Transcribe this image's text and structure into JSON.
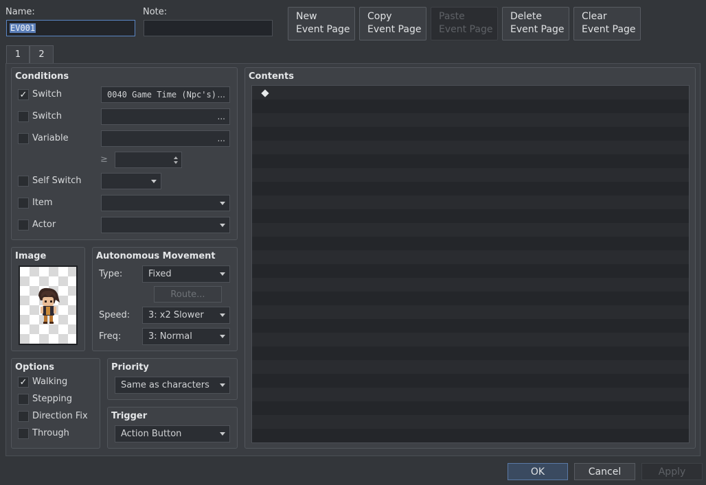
{
  "header": {
    "name_label": "Name:",
    "name_value": "EV001",
    "note_label": "Note:",
    "note_value": ""
  },
  "page_buttons": {
    "new_line1": "New",
    "new_line2": "Event Page",
    "copy_line1": "Copy",
    "copy_line2": "Event Page",
    "paste_line1": "Paste",
    "paste_line2": "Event Page",
    "delete_line1": "Delete",
    "delete_line2": "Event Page",
    "clear_line1": "Clear",
    "clear_line2": "Event Page"
  },
  "tabs": {
    "tab1": "1",
    "tab2": "2",
    "active": "2"
  },
  "conditions": {
    "title": "Conditions",
    "switch1": {
      "label": "Switch",
      "checked": true,
      "value": "0040 Game Time (Npc's)",
      "button": "..."
    },
    "switch2": {
      "label": "Switch",
      "checked": false,
      "value": "",
      "button": "..."
    },
    "variable": {
      "label": "Variable",
      "checked": false,
      "value": "",
      "button": "...",
      "operator": "≥",
      "compare_value": ""
    },
    "self_switch": {
      "label": "Self Switch",
      "checked": false,
      "value": ""
    },
    "item": {
      "label": "Item",
      "checked": false,
      "value": ""
    },
    "actor": {
      "label": "Actor",
      "checked": false,
      "value": ""
    }
  },
  "image": {
    "title": "Image",
    "sprite": "character-sprite"
  },
  "movement": {
    "title": "Autonomous Movement",
    "type_label": "Type:",
    "type_value": "Fixed",
    "route_button": "Route...",
    "speed_label": "Speed:",
    "speed_value": "3: x2 Slower",
    "freq_label": "Freq:",
    "freq_value": "3: Normal"
  },
  "options": {
    "title": "Options",
    "walking": {
      "label": "Walking",
      "checked": true
    },
    "stepping": {
      "label": "Stepping",
      "checked": false
    },
    "direction_fix": {
      "label": "Direction Fix",
      "checked": false
    },
    "through": {
      "label": "Through",
      "checked": false
    }
  },
  "priority": {
    "title": "Priority",
    "value": "Same as characters"
  },
  "trigger": {
    "title": "Trigger",
    "value": "Action Button"
  },
  "contents": {
    "title": "Contents",
    "first_line_marker": "◆"
  },
  "footer": {
    "ok": "OK",
    "cancel": "Cancel",
    "apply": "Apply"
  },
  "colors": {
    "background": "#33363a",
    "accent": "#5a86c4",
    "selection": "#5b7fba"
  }
}
